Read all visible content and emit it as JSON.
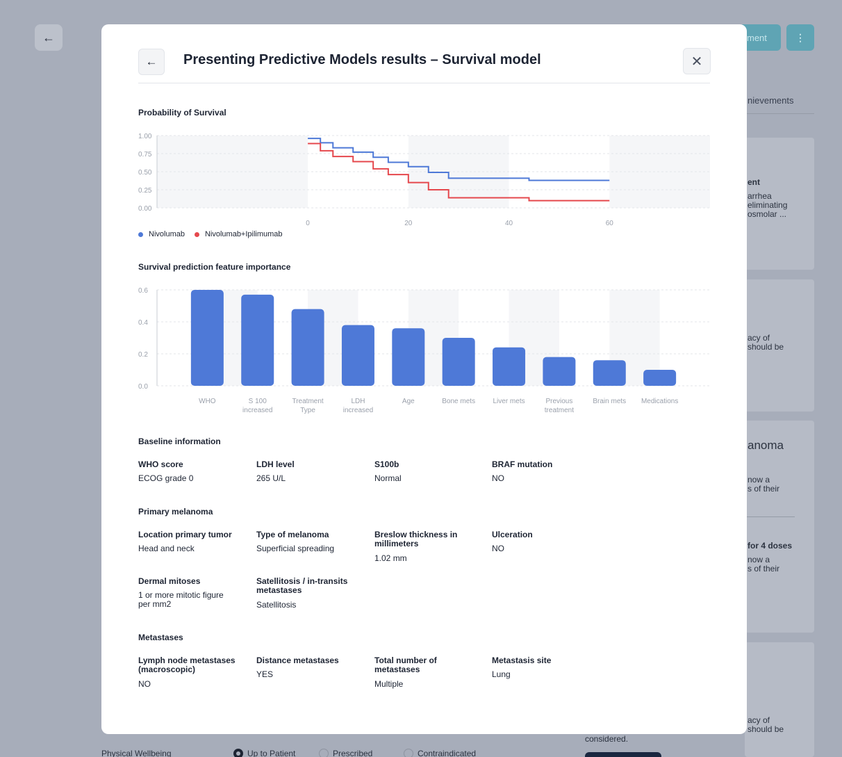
{
  "background": {
    "back_icon": "arrow-left-icon",
    "primary_button_label": "ment",
    "more_icon": "more-vertical-icon",
    "tab_label": "nievements",
    "snippets": {
      "s1_title": "ent",
      "s1_line1": "arrhea",
      "s1_line2": "eliminating",
      "s1_line3": "osmolar ...",
      "s2_line1": "acy of",
      "s2_line2": "should be",
      "heading": "anoma",
      "s3_line1": "now a",
      "s3_line2": "s of their",
      "s4_title": "for 4 doses",
      "s4_line1": "now a",
      "s4_line2": "s of their",
      "s5_line1": "acy of",
      "s5_line2": "should be",
      "considered": "considered."
    },
    "bottom_row": {
      "label": "Physical Wellbeing",
      "options": [
        "Up to Patient",
        "Prescribed",
        "Contraindicated"
      ],
      "selected": "Up to Patient"
    }
  },
  "modal": {
    "back_icon": "arrow-left-icon",
    "title": "Presenting Predictive Models results – Survival model",
    "close_icon": "close-icon",
    "survival_title": "Probability of Survival",
    "importance_title": "Survival prediction feature importance",
    "baseline": {
      "title": "Baseline information",
      "fields": [
        {
          "label": "WHO score",
          "value": "ECOG grade 0"
        },
        {
          "label": "LDH level",
          "value": "265 U/L"
        },
        {
          "label": "S100b",
          "value": "Normal"
        },
        {
          "label": "BRAF mutation",
          "value": "NO"
        }
      ]
    },
    "primary": {
      "title": "Primary melanoma",
      "fields": [
        {
          "label": "Location primary tumor",
          "value": "Head and neck"
        },
        {
          "label": "Type of melanoma",
          "value": "Superficial spreading"
        },
        {
          "label": "Breslow thickness in millimeters",
          "value": "1.02 mm"
        },
        {
          "label": "Ulceration",
          "value": "NO"
        },
        {
          "label": "Dermal mitoses",
          "value": "1 or more mitotic figure per mm2"
        },
        {
          "label": "Satellitosis / in-transits metastases",
          "value": "Satellitosis"
        }
      ]
    },
    "metastases": {
      "title": "Metastases",
      "fields": [
        {
          "label": "Lymph node metastases (macroscopic)",
          "value": "NO"
        },
        {
          "label": "Distance metastases",
          "value": "YES"
        },
        {
          "label": "Total number of metastases",
          "value": "Multiple"
        },
        {
          "label": "Metastasis site",
          "value": "Lung"
        }
      ]
    }
  },
  "chart_data": [
    {
      "type": "line",
      "title": "Probability of Survival",
      "xlim": [
        -30,
        80
      ],
      "ylim": [
        0,
        1
      ],
      "x_ticks": [
        "0",
        "20",
        "40",
        "60"
      ],
      "y_ticks": [
        "0.00",
        "0.25",
        "0.50",
        "0.75",
        "1.00"
      ],
      "legend_position": "bottom-left",
      "series": [
        {
          "name": "Nivolumab",
          "color": "#4e79d7",
          "x": [
            0,
            2.5,
            2.5,
            5,
            5,
            9,
            9,
            13,
            13,
            16,
            16,
            20,
            20,
            24,
            24,
            28,
            28,
            44,
            44,
            60
          ],
          "y": [
            0.96,
            0.96,
            0.9,
            0.9,
            0.83,
            0.83,
            0.77,
            0.77,
            0.7,
            0.7,
            0.63,
            0.63,
            0.57,
            0.57,
            0.49,
            0.49,
            0.41,
            0.41,
            0.38,
            0.38
          ]
        },
        {
          "name": "Nivolumab+Ipilimumab",
          "color": "#e5484d",
          "x": [
            0,
            2.5,
            2.5,
            5,
            5,
            9,
            9,
            13,
            13,
            16,
            16,
            20,
            20,
            24,
            24,
            28,
            28,
            44,
            44,
            60
          ],
          "y": [
            0.89,
            0.89,
            0.79,
            0.79,
            0.71,
            0.71,
            0.64,
            0.64,
            0.54,
            0.54,
            0.46,
            0.46,
            0.35,
            0.35,
            0.25,
            0.25,
            0.14,
            0.14,
            0.1,
            0.1
          ]
        }
      ]
    },
    {
      "type": "bar",
      "title": "Survival prediction feature importance",
      "categories": [
        "WHO",
        "S 100 increased",
        "Treatment Type",
        "LDH increased",
        "Age",
        "Bone mets",
        "Liver mets",
        "Previous treatment",
        "Brain mets",
        "Medications"
      ],
      "category_lines": [
        [
          "WHO"
        ],
        [
          "S 100",
          "increased"
        ],
        [
          "Treatment",
          "Type"
        ],
        [
          "LDH",
          "increased"
        ],
        [
          "Age"
        ],
        [
          "Bone mets"
        ],
        [
          "Liver mets"
        ],
        [
          "Previous",
          "treatment"
        ],
        [
          "Brain mets"
        ],
        [
          "Medications"
        ]
      ],
      "values": [
        0.6,
        0.57,
        0.48,
        0.38,
        0.36,
        0.3,
        0.24,
        0.18,
        0.16,
        0.1
      ],
      "ylim": [
        0,
        0.6
      ],
      "y_ticks": [
        "0.0",
        "0.2",
        "0.4",
        "0.6"
      ],
      "color": "#4e79d7"
    }
  ]
}
